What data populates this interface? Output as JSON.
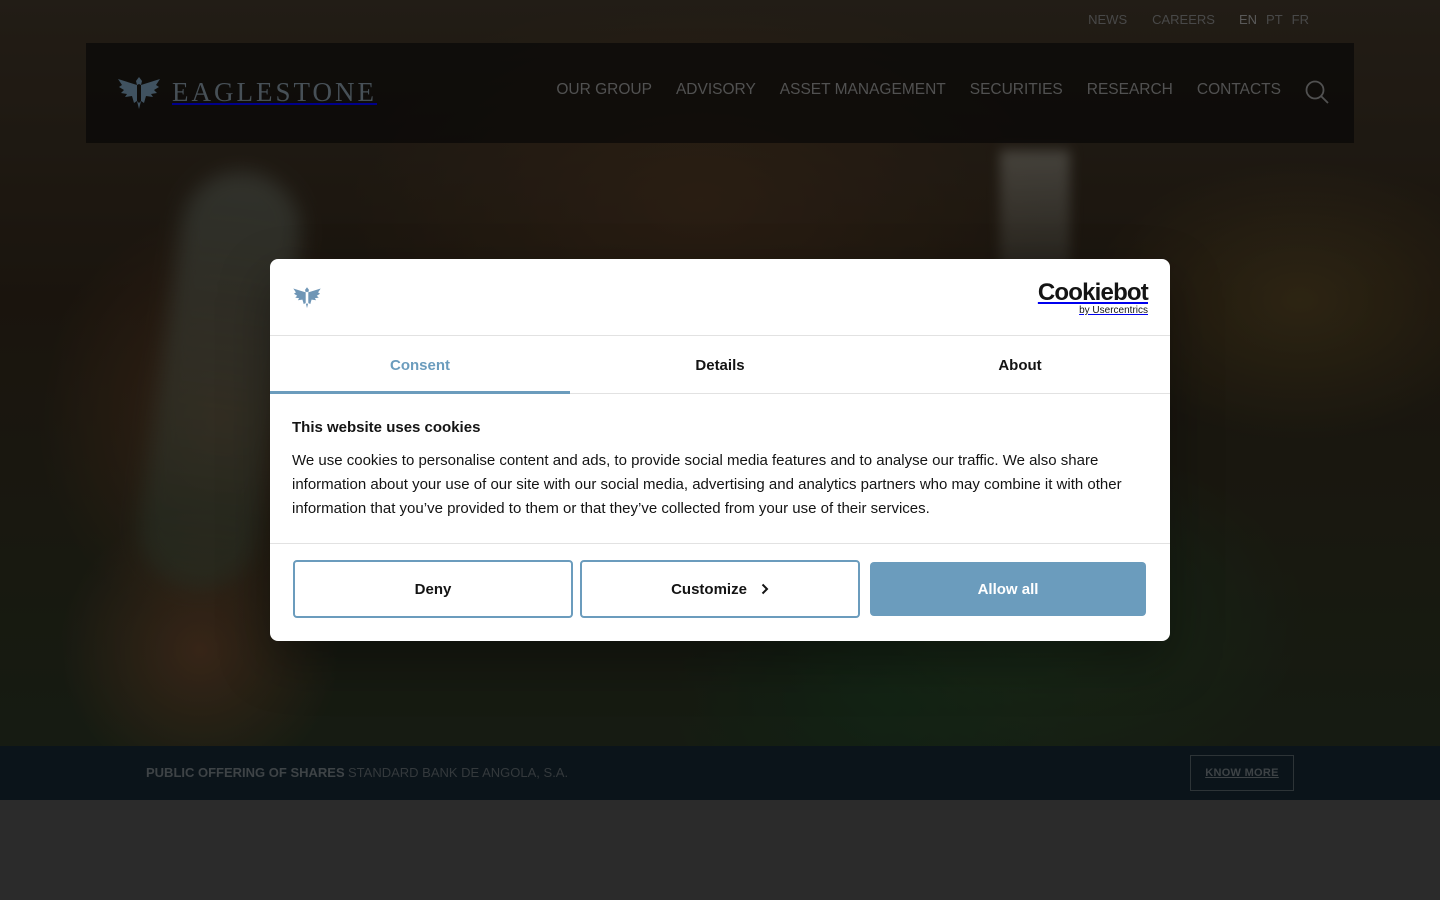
{
  "site": {
    "logo_text": "EAGLESTONE",
    "top_links": {
      "news": "NEWS",
      "careers": "CAREERS"
    },
    "languages": [
      "EN",
      "PT",
      "FR"
    ],
    "main_nav": [
      "OUR GROUP",
      "ADVISORY",
      "ASSET MANAGEMENT",
      "SECURITIES",
      "RESEARCH",
      "CONTACTS"
    ]
  },
  "banner": {
    "label": "PUBLIC OFFERING OF SHARES",
    "value": "STANDARD BANK DE ANGOLA, S.A.",
    "button": "KNOW MORE"
  },
  "cookie_dialog": {
    "brand": "Cookiebot",
    "brand_sub": "by Usercentrics",
    "tabs": [
      "Consent",
      "Details",
      "About"
    ],
    "active_tab": "Consent",
    "title": "This website uses cookies",
    "text": "We use cookies to personalise content and ads, to provide social media features and to analyse our traffic. We also share information about your use of our site with our social media, advertising and analytics partners who may combine it with other information that you’ve provided to them or that they’ve collected from your use of their services.",
    "buttons": {
      "deny": "Deny",
      "customize": "Customize",
      "allow": "Allow all"
    },
    "accent_color": "#6b9cbd"
  }
}
